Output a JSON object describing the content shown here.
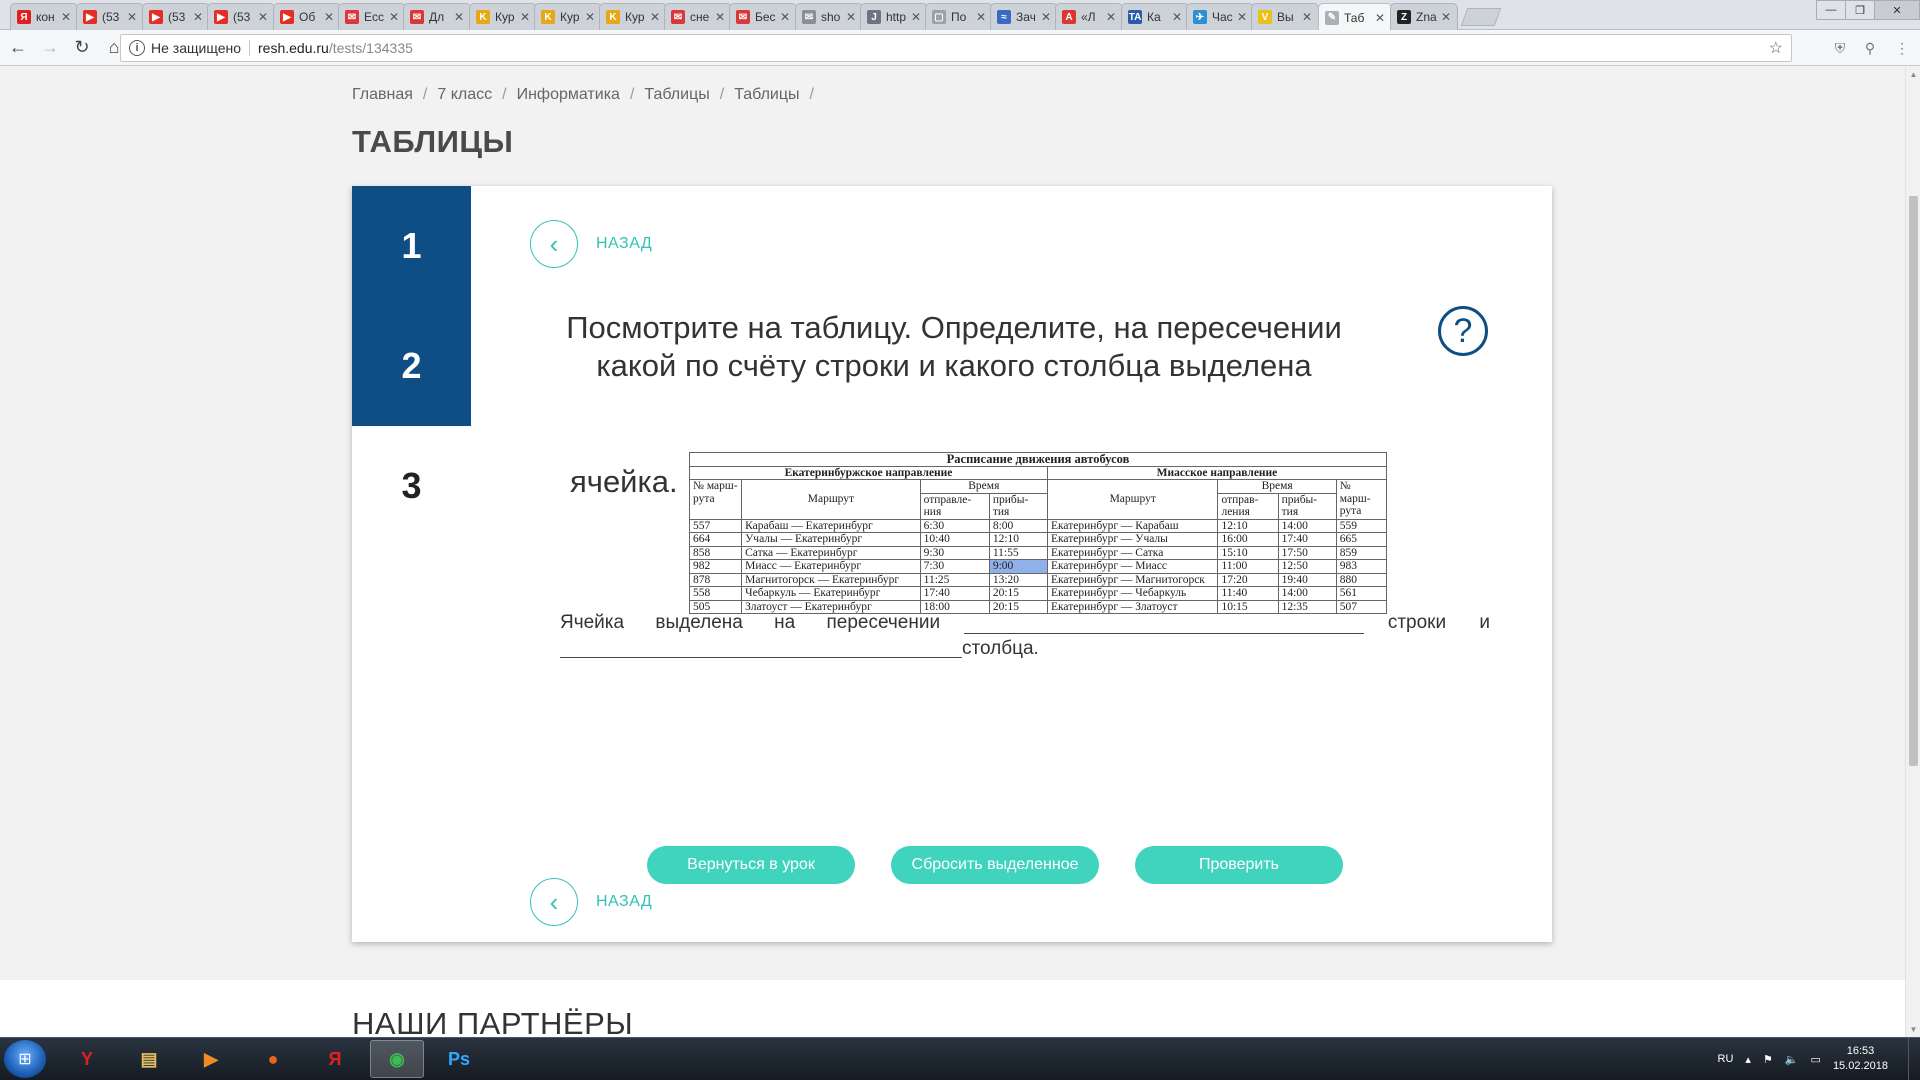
{
  "browser": {
    "tabs": [
      {
        "title": "кон",
        "icon": "yandex",
        "color": "#e02020",
        "glyph": "Я"
      },
      {
        "title": "(53",
        "icon": "youtube",
        "color": "#e52d27",
        "glyph": "▶"
      },
      {
        "title": "(53",
        "icon": "youtube",
        "color": "#e52d27",
        "glyph": "▶"
      },
      {
        "title": "(53",
        "icon": "youtube",
        "color": "#e52d27",
        "glyph": "▶"
      },
      {
        "title": "Об",
        "icon": "youtube",
        "color": "#e52d27",
        "glyph": "▶"
      },
      {
        "title": "Ecc",
        "icon": "pocket",
        "color": "#d93838",
        "glyph": "✉"
      },
      {
        "title": "Дл",
        "icon": "pocket",
        "color": "#d93838",
        "glyph": "✉"
      },
      {
        "title": "Кур",
        "icon": "kurs",
        "color": "#e6a817",
        "glyph": "K"
      },
      {
        "title": "Кур",
        "icon": "kurs",
        "color": "#e6a817",
        "glyph": "K"
      },
      {
        "title": "Кур",
        "icon": "kurs",
        "color": "#e6a817",
        "glyph": "K"
      },
      {
        "title": "сне",
        "icon": "pocket",
        "color": "#d93838",
        "glyph": "✉"
      },
      {
        "title": "Бес",
        "icon": "pocket",
        "color": "#d93838",
        "glyph": "✉"
      },
      {
        "title": "sho",
        "icon": "mail",
        "color": "#8a8f96",
        "glyph": "✉"
      },
      {
        "title": "http",
        "icon": "page",
        "color": "#6b7480",
        "glyph": "J"
      },
      {
        "title": "По",
        "icon": "doc",
        "color": "#9aa1a9",
        "glyph": "▢"
      },
      {
        "title": "Зач",
        "icon": "site",
        "color": "#3a6bc4",
        "glyph": "≈"
      },
      {
        "title": "«Л",
        "icon": "site",
        "color": "#d9382e",
        "glyph": "A"
      },
      {
        "title": "Ка",
        "icon": "site",
        "color": "#2a5aa8",
        "glyph": "TA"
      },
      {
        "title": "Час",
        "icon": "site",
        "color": "#2d8fd6",
        "glyph": "✈"
      },
      {
        "title": "Вы",
        "icon": "site",
        "color": "#e8c21a",
        "glyph": "V"
      },
      {
        "title": "Таб",
        "icon": "resh",
        "color": "#aab0b8",
        "glyph": "✎",
        "active": true
      },
      {
        "title": "Zna",
        "icon": "znanija",
        "color": "#222222",
        "glyph": "Z"
      }
    ],
    "address": {
      "security_label": "Не защищено",
      "host": "resh.edu.ru",
      "path": "/tests/134335"
    }
  },
  "page": {
    "breadcrumb": [
      "Главная",
      "7 класс",
      "Информатика",
      "Таблицы",
      "Таблицы"
    ],
    "breadcrumb_sep": "/",
    "title": "ТАБЛИЦЫ",
    "steps": [
      "1",
      "2",
      "3"
    ],
    "current_step": "3",
    "back_label": "НАЗАД",
    "help_glyph": "?",
    "question": "Посмотрите на таблицу. Определите, на пересечении какой по счёту строки и какого столбца выделена",
    "question_tail": "ячейка.",
    "answer": {
      "part1": "Ячейка выделена на пересечении",
      "part2": "строки и",
      "part3": "столбца."
    },
    "buttons": {
      "back_to_lesson": "Вернуться в урок",
      "reset": "Сбросить выделенное",
      "check": "Проверить"
    },
    "partners_title": "НАШИ ПАРТНЁРЫ"
  },
  "timetable": {
    "title": "Расписание движения автобусов",
    "dir_left": "Екатеринбуржское направление",
    "dir_right": "Миасское направление",
    "h_num": "№ марш-рута",
    "h_route": "Маршрут",
    "h_time": "Время",
    "h_dep_left": "отправле-ния",
    "h_arr_left": "прибы-тия",
    "h_dep_right": "отправ-ления",
    "h_arr_right": "прибы-тия",
    "rows": [
      [
        "557",
        "Карабаш — Екатеринбург",
        "6:30",
        "8:00",
        "Екатеринбург — Карабаш",
        "12:10",
        "14:00",
        "559"
      ],
      [
        "664",
        "Учалы — Екатеринбург",
        "10:40",
        "12:10",
        "Екатеринбург — Учалы",
        "16:00",
        "17:40",
        "665"
      ],
      [
        "858",
        "Сатка — Екатеринбург",
        "9:30",
        "11:55",
        "Екатеринбург — Сатка",
        "15:10",
        "17:50",
        "859"
      ],
      [
        "982",
        "Миасс — Екатеринбург",
        "7:30",
        "9:00",
        "Екатеринбург — Миасс",
        "11:00",
        "12:50",
        "983"
      ],
      [
        "878",
        "Магнитогорск — Екатеринбург",
        "11:25",
        "13:20",
        "Екатеринбург — Магнитогорск",
        "17:20",
        "19:40",
        "880"
      ],
      [
        "558",
        "Чебаркуль — Екатеринбург",
        "17:40",
        "20:15",
        "Екатеринбург — Чебаркуль",
        "11:40",
        "14:00",
        "561"
      ],
      [
        "505",
        "Златоуст — Екатеринбург",
        "18:00",
        "20:15",
        "Екатеринбург — Златоуст",
        "10:15",
        "12:35",
        "507"
      ]
    ],
    "highlight": {
      "row": 3,
      "col": 3
    },
    "highlight_color": "#8fb0e8"
  },
  "taskbar": {
    "apps": [
      {
        "name": "yandex-browser",
        "glyph": "Y",
        "color": "#e02020"
      },
      {
        "name": "explorer",
        "glyph": "▤",
        "color": "#e8c060"
      },
      {
        "name": "media-player",
        "glyph": "▶",
        "color": "#f08a24"
      },
      {
        "name": "firefox",
        "glyph": "●",
        "color": "#e8661a"
      },
      {
        "name": "yandex",
        "glyph": "Я",
        "color": "#e02020"
      },
      {
        "name": "chrome",
        "glyph": "◉",
        "color": "#3cba54",
        "active": true
      },
      {
        "name": "photoshop",
        "glyph": "Ps",
        "color": "#31a8ff"
      }
    ],
    "lang": "RU",
    "time": "16:53",
    "date": "15.02.2018"
  },
  "colors": {
    "accent": "#40d4bf",
    "accent_line": "#34c2b6",
    "step_blue": "#0e4e85"
  }
}
